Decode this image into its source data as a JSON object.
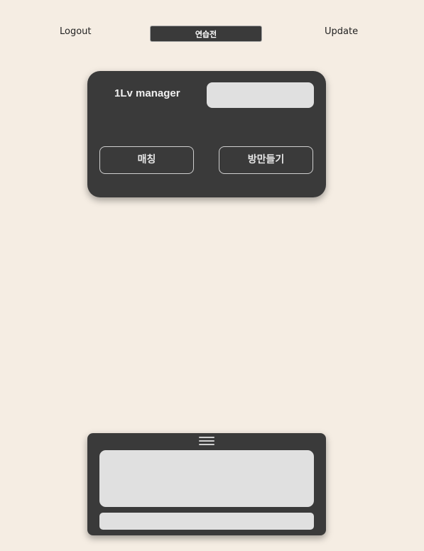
{
  "header": {
    "logout_label": "Logout",
    "mode_label": "연습전",
    "update_label": "Update"
  },
  "profile": {
    "username": "1Lv manager",
    "status_value": ""
  },
  "actions": {
    "match_label": "매칭",
    "create_room_label": "방만들기"
  },
  "chat": {
    "menu_icon": "hamburger-menu-icon",
    "log_text": "",
    "input_value": "",
    "input_placeholder": ""
  },
  "colors": {
    "background": "#f5ede3",
    "panel": "#3a3a3a",
    "field": "#e0e0e0"
  }
}
